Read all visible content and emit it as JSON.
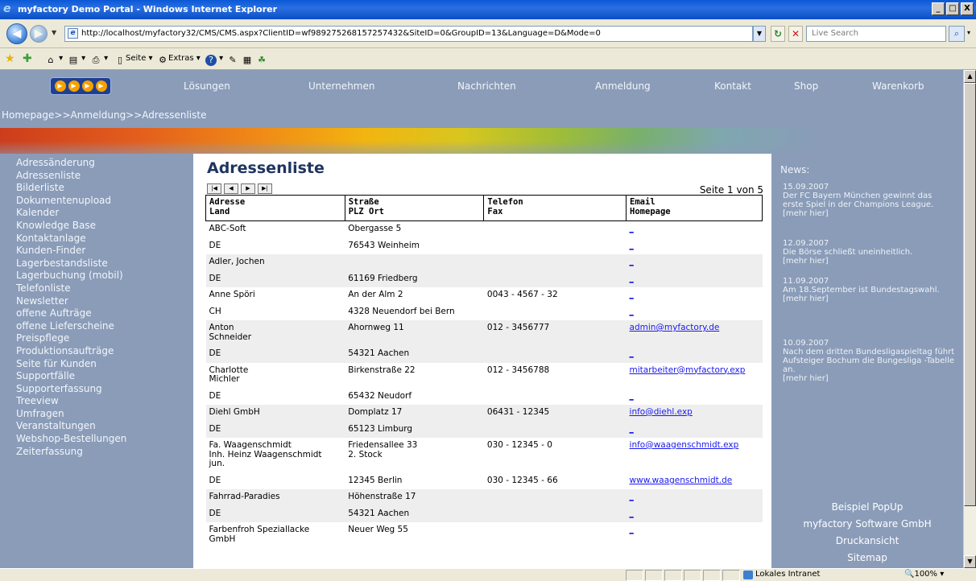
{
  "window": {
    "title": "myfactory Demo Portal - Windows Internet Explorer",
    "min": "_",
    "max": "□",
    "close": "X"
  },
  "address_bar": {
    "url": "http://localhost/myfactory32/CMS/CMS.aspx?ClientID=wf98927526815725743​2&SiteID=0&GroupID=13&Language=D&Mode=0",
    "search_placeholder": "Live Search"
  },
  "command_bar": {
    "page_label": "Seite",
    "extras_label": "Extras"
  },
  "top_nav": [
    "Lösungen",
    "Unternehmen",
    "Nachrichten",
    "Anmeldung",
    "Kontakt",
    "Shop",
    "Warenkorb"
  ],
  "breadcrumb": "Homepage>>Anmeldung>>Adressenliste",
  "left_nav": [
    "Adressänderung",
    "Adressenliste",
    "Bilderliste",
    "Dokumentenupload",
    "Kalender",
    "Knowledge Base",
    "Kontaktanlage",
    "Kunden-Finder",
    "Lagerbestandsliste",
    "Lagerbuchung (mobil)",
    "Telefonliste",
    "Newsletter",
    "offene Aufträge",
    "offene Lieferscheine",
    "Preispflege",
    "Produktionsaufträge",
    "Seite für Kunden",
    "Supportfälle",
    "Supporterfassung",
    "Treeview",
    "Umfragen",
    "Veranstaltungen",
    "Webshop-Bestellungen",
    "Zeiterfassung"
  ],
  "content": {
    "title": "Adressenliste",
    "pager": {
      "first": "|◀",
      "prev": "◀",
      "next": "▶",
      "last": "▶|"
    },
    "page_info": "Seite 1 von 5",
    "headers": [
      {
        "line1": "Adresse",
        "line2": "Land"
      },
      {
        "line1": "Straße",
        "line2": "PLZ Ort"
      },
      {
        "line1": "Telefon",
        "line2": "Fax"
      },
      {
        "line1": "Email",
        "line2": "Homepage"
      }
    ],
    "rows": [
      {
        "name": "ABC-Soft",
        "street": "Obergasse 5",
        "phone": "",
        "email": "_",
        "country": "DE",
        "city": "76543 Weinheim",
        "fax": "",
        "homepage": "_"
      },
      {
        "name": "Adler, Jochen",
        "street": "",
        "phone": "",
        "email": "_",
        "country": "DE",
        "city": "61169 Friedberg",
        "fax": "",
        "homepage": "_"
      },
      {
        "name": "Anne Spöri",
        "street": "An der Alm 2",
        "phone": "0043 - 4567 - 32",
        "email": "_",
        "country": "CH",
        "city": "4328 Neuendorf bei Bern",
        "fax": "",
        "homepage": "_"
      },
      {
        "name": "Anton\nSchneider",
        "street": "Ahornweg 11",
        "phone": "012 - 3456777",
        "email": "admin@myfactory.de",
        "country": "DE",
        "city": "54321 Aachen",
        "fax": "",
        "homepage": "_"
      },
      {
        "name": "Charlotte\nMichler",
        "street": "Birkenstraße 22",
        "phone": "012 - 3456788",
        "email": "mitarbeiter@myfactory.exp",
        "country": "DE",
        "city": "65432 Neudorf",
        "fax": "",
        "homepage": "_"
      },
      {
        "name": "Diehl GmbH",
        "street": "Domplatz 17",
        "phone": "06431 - 12345",
        "email": "info@diehl.exp",
        "country": "DE",
        "city": "65123 Limburg",
        "fax": "",
        "homepage": "_"
      },
      {
        "name": "Fa. Waagenschmidt\nInh. Heinz Waagenschmidt\njun.",
        "street": "Friedensallee 33\n2. Stock",
        "phone": "030 - 12345 - 0",
        "email": "info@waagenschmidt.exp",
        "country": "DE",
        "city": "12345 Berlin",
        "fax": "030 - 12345 - 66",
        "homepage": "www.waagenschmidt.de"
      },
      {
        "name": "Fahrrad-Paradies",
        "street": "Höhenstraße 17",
        "phone": "",
        "email": "_",
        "country": "DE",
        "city": "54321 Aachen",
        "fax": "",
        "homepage": "_"
      },
      {
        "name": "Farbenfroh Speziallacke\nGmbH",
        "street": "Neuer Weg 55",
        "phone": "",
        "email": "_",
        "country": "",
        "city": "",
        "fax": "",
        "homepage": ""
      }
    ]
  },
  "news": {
    "title": "News:",
    "items": [
      {
        "date": "15.09.2007",
        "text": "Der FC Bayern München gewinnt das erste Spiel in der Champions League.",
        "more": "[mehr hier]"
      },
      {
        "date": "12.09.2007",
        "text": "Die Börse schließt uneinheitlich.",
        "more": "[mehr hier]"
      },
      {
        "date": "11.09.2007",
        "text": "Am 18.September ist Bundestagswahl.",
        "more": "[mehr hier]"
      },
      {
        "date": "10.09.2007",
        "text": "Nach dem dritten Bundesligaspieltag führt Aufsteiger Bochum die Bungesliga -Tabelle an.",
        "more": "[mehr hier]"
      }
    ]
  },
  "footer_links": [
    "Beispiel PopUp",
    "myfactory Software GmbH",
    "Druckansicht",
    "Sitemap"
  ],
  "status_bar": {
    "zone": "Lokales Intranet",
    "zoom": "100%"
  }
}
